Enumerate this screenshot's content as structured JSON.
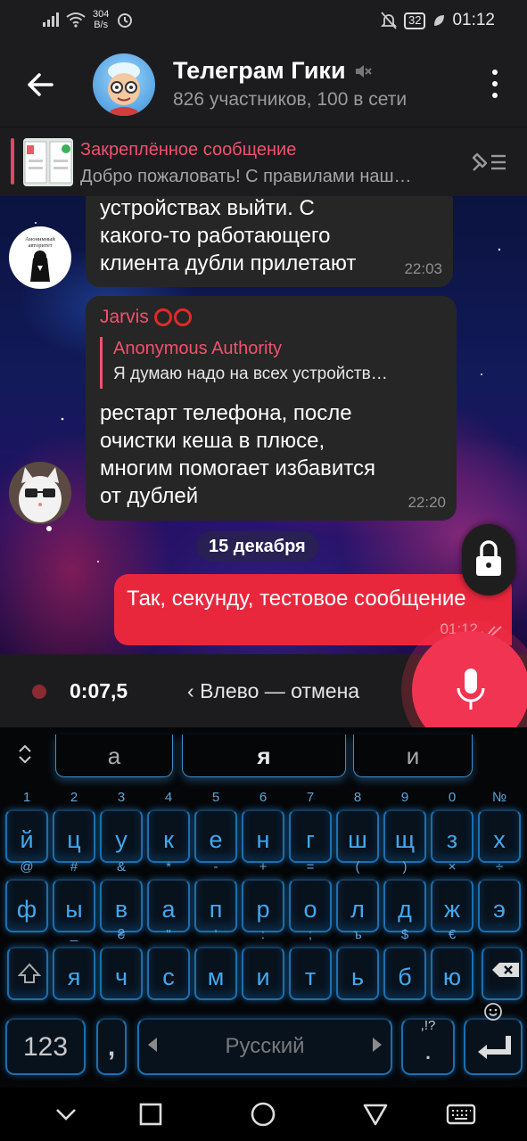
{
  "status_bar": {
    "net_speed_value": "304",
    "net_speed_unit": "B/s",
    "battery": "32",
    "time": "01:12"
  },
  "header": {
    "title": "Телеграм Гики",
    "subtitle": "826 участников, 100 в сети",
    "muted_icon": "muted-speaker-icon"
  },
  "pinned": {
    "title": "Закреплённое сообщение",
    "text": "Добро пожаловать! С правилами наш…"
  },
  "messages": {
    "m1": {
      "lines": [
        "устройствах выйти. С",
        "какого-то работающего",
        "клиента дубли прилетают"
      ],
      "time": "22:03",
      "avatar_text": "Анонимный авторитет"
    },
    "m2": {
      "sender": "Jarvis",
      "reply_name": "Anonymous Authority",
      "reply_text": "Я думаю надо на всех устройств…",
      "lines": [
        "рестарт телефона, после",
        "очистки кеша в плюсе,",
        "многим помогает избавится",
        "от дублей"
      ],
      "time": "22:20"
    },
    "date_separator": "15 декабря",
    "m3": {
      "text": "Так, секунду, тестовое сообщение",
      "time": "01:12"
    }
  },
  "recording": {
    "duration": "0:07,5",
    "hint": "Влево — отмена"
  },
  "keyboard": {
    "suggestions": [
      "а",
      "я",
      "и"
    ],
    "row1": [
      [
        "1",
        "й"
      ],
      [
        "2",
        "ц"
      ],
      [
        "3",
        "у"
      ],
      [
        "4",
        "к"
      ],
      [
        "5",
        "е"
      ],
      [
        "6",
        "н"
      ],
      [
        "7",
        "г"
      ],
      [
        "8",
        "ш"
      ],
      [
        "9",
        "щ"
      ],
      [
        "0",
        "з"
      ],
      [
        "№",
        "х"
      ]
    ],
    "row2": [
      [
        "@",
        "ф"
      ],
      [
        "#",
        "ы"
      ],
      [
        "&",
        "в"
      ],
      [
        "*",
        "а"
      ],
      [
        "-",
        "п"
      ],
      [
        "+",
        "р"
      ],
      [
        "=",
        "о"
      ],
      [
        "(",
        "л"
      ],
      [
        ")",
        "д"
      ],
      [
        "×",
        "ж"
      ],
      [
        "÷",
        "э"
      ]
    ],
    "row3": [
      [
        "_",
        "я"
      ],
      [
        "₴",
        "ч"
      ],
      [
        "\"",
        "с"
      ],
      [
        "'",
        "м"
      ],
      [
        ":",
        "и"
      ],
      [
        ";",
        "т"
      ],
      [
        "ъ",
        "ь"
      ],
      [
        "$",
        "б"
      ],
      [
        "€",
        "ю"
      ]
    ],
    "numbers_key": "123",
    "comma_key": ",",
    "space_label": "Русский",
    "punct_hint": ",!?",
    "period_key": "."
  }
}
